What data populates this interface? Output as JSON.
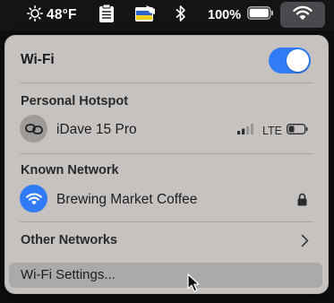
{
  "menubar": {
    "weather_temp": "48°F",
    "battery_percent": "100%",
    "battery_level": 1.0,
    "icons": [
      "sun-icon",
      "clipboard-icon",
      "flag-app-icon",
      "bluetooth-icon",
      "battery-icon",
      "wifi-icon"
    ]
  },
  "wifi_panel": {
    "title": "Wi-Fi",
    "toggle_on": true,
    "toggle_color": "#2f7cf6",
    "hotspot": {
      "header": "Personal Hotspot",
      "device_name": "iDave 15 Pro",
      "network_type": "LTE",
      "signal_bars": 2,
      "signal_bars_total": 4,
      "battery_level": 0.3
    },
    "known": {
      "header": "Known Network",
      "network_name": "Brewing Market Coffee",
      "secured": true
    },
    "other_networks_label": "Other Networks",
    "settings_label": "Wi-Fi Settings..."
  }
}
